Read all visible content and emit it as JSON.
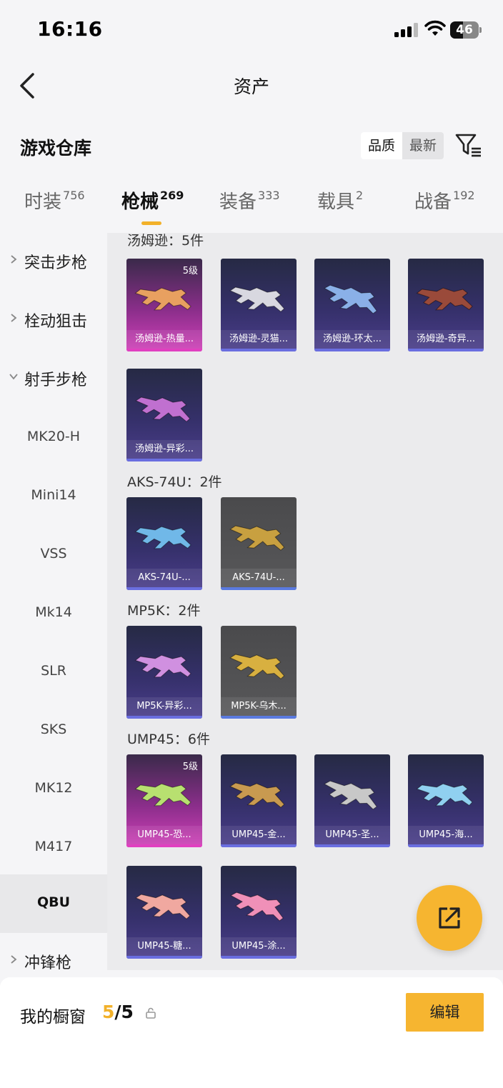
{
  "status_bar": {
    "time": "16:16",
    "battery": "46",
    "battery_level": 0.46
  },
  "header": {
    "title": "资产"
  },
  "section": {
    "title": "游戏仓库"
  },
  "sort": {
    "quality": "品质",
    "latest": "最新"
  },
  "tabs": [
    {
      "label": "时装",
      "count": "756"
    },
    {
      "label": "枪械",
      "count": "269"
    },
    {
      "label": "装备",
      "count": "333"
    },
    {
      "label": "载具",
      "count": "2"
    },
    {
      "label": "战备",
      "count": "192"
    }
  ],
  "sidebar": {
    "items": [
      {
        "label": "突击步枪"
      },
      {
        "label": "栓动狙击"
      },
      {
        "label": "射手步枪"
      },
      {
        "label": "MK20-H"
      },
      {
        "label": "Mini14"
      },
      {
        "label": "VSS"
      },
      {
        "label": "Mk14"
      },
      {
        "label": "SLR"
      },
      {
        "label": "SKS"
      },
      {
        "label": "MK12"
      },
      {
        "label": "M417"
      },
      {
        "label": "QBU"
      },
      {
        "label": "冲锋枪"
      }
    ]
  },
  "groups": [
    {
      "title": "汤姆逊：5件",
      "items": [
        {
          "name": "汤姆逊-热量...",
          "grade": "5级",
          "color": "#e8a060"
        },
        {
          "name": "汤姆逊-灵猫...",
          "color": "#d8d8e0"
        },
        {
          "name": "汤姆逊-环太...",
          "color": "#8ab0e8"
        },
        {
          "name": "汤姆逊-奇异...",
          "color": "#9a4a3a"
        },
        {
          "name": "汤姆逊-异彩...",
          "color": "#c070d0"
        }
      ]
    },
    {
      "title": "AKS-74U：2件",
      "items": [
        {
          "name": "AKS-74U-...",
          "color": "#70b8e8"
        },
        {
          "name": "AKS-74U-...",
          "color": "#c8a040"
        }
      ]
    },
    {
      "title": "MP5K：2件",
      "items": [
        {
          "name": "MP5K-异彩...",
          "color": "#d090e0"
        },
        {
          "name": "MP5K-乌木...",
          "color": "#d8b040"
        }
      ]
    },
    {
      "title": "UMP45：6件",
      "items": [
        {
          "name": "UMP45-恐...",
          "grade": "5级",
          "color": "#b8e070"
        },
        {
          "name": "UMP45-金...",
          "color": "#c89a50"
        },
        {
          "name": "UMP45-圣...",
          "color": "#c8c8c8"
        },
        {
          "name": "UMP45-海...",
          "color": "#90d0f0"
        },
        {
          "name": "UMP45-糖...",
          "color": "#f0a8a0"
        },
        {
          "name": "UMP45-涂...",
          "color": "#f090b8"
        }
      ]
    }
  ],
  "showcase": {
    "label": "我的橱窗",
    "current": "5",
    "total": "/5",
    "edit": "编辑"
  }
}
